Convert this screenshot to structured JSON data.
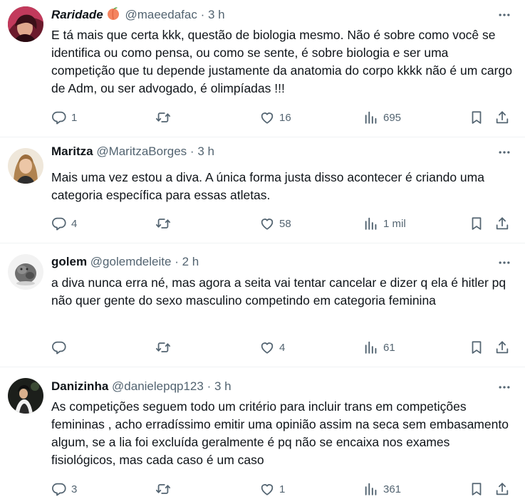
{
  "tweets": [
    {
      "name": "Raridade",
      "handle": "@maeedafac",
      "time": "3 h",
      "text": "E tá mais que certa kkk, questão de biologia mesmo. Não é sobre como você se identifica ou como pensa, ou como se sente, é sobre biologia e ser uma competição que tu depende justamente da anatomia do corpo kkkk não é um cargo de Adm, ou ser advogado, é olimpíadas !!!",
      "replies": "1",
      "retweets": "",
      "likes": "16",
      "views": "695"
    },
    {
      "name": "Maritza",
      "handle": "@MaritzaBorges",
      "time": "3 h",
      "text": "Mais uma vez estou a diva. A única forma justa disso acontecer é criando uma categoria específica para essas atletas.",
      "replies": "4",
      "retweets": "",
      "likes": "58",
      "views": "1 mil"
    },
    {
      "name": "golem",
      "handle": "@golemdeleite",
      "time": "2 h",
      "text": "a diva nunca erra né, mas agora a seita vai tentar cancelar e dizer q ela é hitler pq não quer gente do sexo masculino competindo em categoria feminina",
      "replies": "",
      "retweets": "",
      "likes": "4",
      "views": "61"
    },
    {
      "name": "Danizinha",
      "handle": "@danielepqp123",
      "time": "3 h",
      "text": "As competições seguem todo um critério para incluir trans em competições femininas , acho erradíssimo emitir uma opinião assim na seca sem embasamento algum, se a lia foi excluída geralmente é pq não se encaixa nos exames fisiológicos, mas cada caso é um caso",
      "replies": "3",
      "retweets": "",
      "likes": "1",
      "views": "361"
    }
  ],
  "separator": "·",
  "colors": {
    "text": "#0f1419",
    "secondary": "#536471",
    "divider": "#eff3f4"
  },
  "icons": [
    "avatar",
    "peach-emoji-icon",
    "more-icon",
    "reply-icon",
    "retweet-icon",
    "like-icon",
    "views-icon",
    "bookmark-icon",
    "share-icon"
  ]
}
